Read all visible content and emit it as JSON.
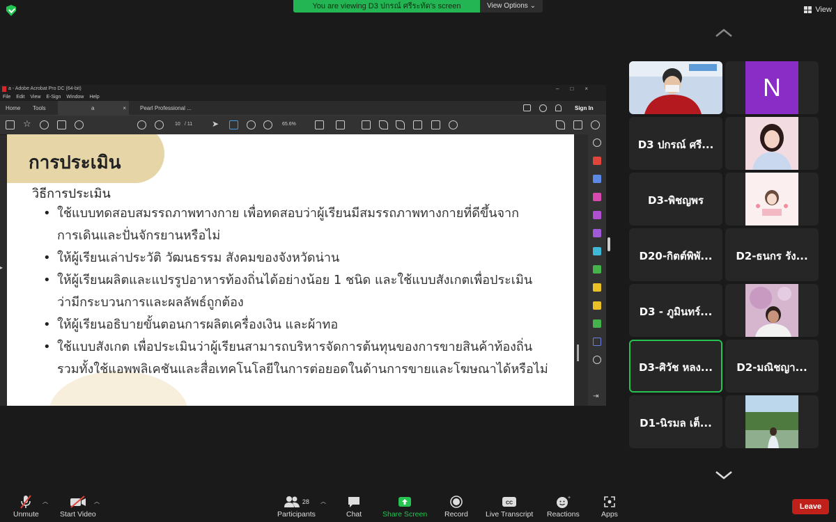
{
  "banner": {
    "viewing_text": "You are viewing D3 ปกรณ์ ศรีระทัด's screen",
    "view_options_label": "View Options",
    "view_label": "View"
  },
  "acrobat": {
    "window_title": "a - Adobe Acrobat Pro DC (64-bit)",
    "menu": [
      "File",
      "Edit",
      "View",
      "E-Sign",
      "Window",
      "Help"
    ],
    "tabs": {
      "home": "Home",
      "tools": "Tools",
      "doc": "a",
      "doc2": "Pearl Professional ..."
    },
    "sign_in": "Sign In",
    "page_current": "10",
    "page_total": "/ 11",
    "zoom": "65.6%"
  },
  "slide": {
    "title": "การประเมิน",
    "subtitle": "วิธีการประเมิน",
    "bullets": [
      "ใช้แบบทดสอบสมรรถภาพทางกาย เพื่อทดสอบว่าผู้เรียนมีสมรรถภาพทางกายที่ดีขึ้นจาก\nการเดินและปั่นจักรยานหรือไม่",
      "ให้ผู้เรียนเล่าประวัติ วัฒนธรรม สังคมของจังหวัดน่าน",
      "ให้ผู้เรียนผลิตและแปรรูปอาหารท้องถิ่นได้อย่างน้อย 1 ชนิด และใช้แบบสังเกตเพื่อประเมิน\nว่ามีกระบวนการและผลลัพธ์ถูกต้อง",
      "ให้ผู้เรียนอธิบายขั้นตอนการผลิตเครื่องเงิน และผ้าทอ",
      "ใช้แบบสังเกต เพื่อประเมินว่าผู้เรียนสามารถบริหารจัดการต้นทุนของการขายสินค้าท้องถิ่น\nรวมทั้งใช้แอพพลิเคชันและสื่อเทคโนโลยีในการต่อยอดในด้านการขายและโฆษณาได้หรือไม่"
    ]
  },
  "participants": {
    "n_initial": "N",
    "names": [
      "D3 ปกรณ์ ศรี...",
      "D3-พิชญพร",
      "D20-กิตต์พิพั...",
      "D2-ธนกร รัง...",
      "D3 - ภูมินทร์...",
      "D3-ศิวัช หลง...",
      "D2-มณิชญา...",
      "D1-นิรมล เต็..."
    ]
  },
  "toolbar": {
    "unmute": "Unmute",
    "start_video": "Start Video",
    "participants": "Participants",
    "participant_count": "28",
    "chat": "Chat",
    "share_screen": "Share Screen",
    "record": "Record",
    "live_transcript": "Live Transcript",
    "reactions": "Reactions",
    "apps": "Apps",
    "leave": "Leave"
  },
  "colors": {
    "accent_green": "#27c352",
    "leave_red": "#c0201a",
    "slide_tan": "#e6d5a7"
  }
}
